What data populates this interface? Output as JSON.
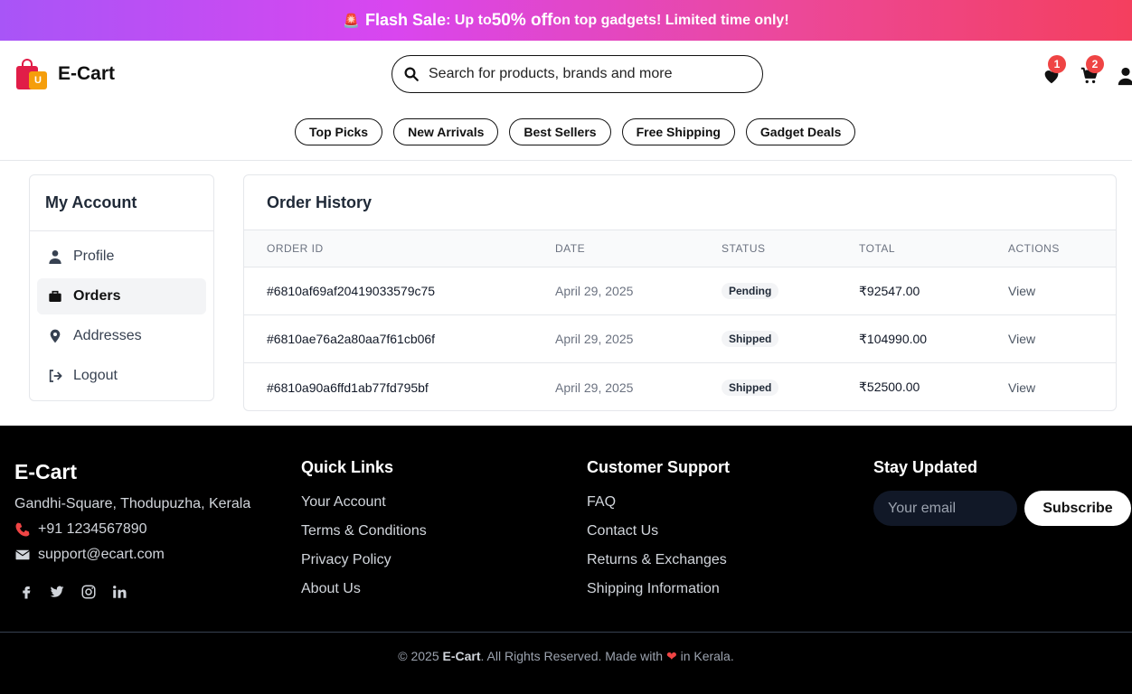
{
  "banner": {
    "siren": "🚨",
    "flash": "Flash Sale",
    "pre": ": Up to ",
    "discount": "50% off",
    "post": " on top gadgets! Limited time only!"
  },
  "header": {
    "brand": "E-Cart",
    "logo_letter": "U",
    "search_placeholder": "Search for products, brands and more",
    "wishlist_count": "1",
    "cart_count": "2",
    "chips": [
      "Top Picks",
      "New Arrivals",
      "Best Sellers",
      "Free Shipping",
      "Gadget Deals"
    ]
  },
  "sidebar": {
    "title": "My Account",
    "items": [
      {
        "label": "Profile",
        "icon": "user-icon"
      },
      {
        "label": "Orders",
        "icon": "briefcase-icon",
        "active": true
      },
      {
        "label": "Addresses",
        "icon": "map-pin-icon"
      },
      {
        "label": "Logout",
        "icon": "logout-icon"
      }
    ]
  },
  "orders": {
    "title": "Order History",
    "columns": [
      "ORDER ID",
      "DATE",
      "STATUS",
      "TOTAL",
      "ACTIONS"
    ],
    "rows": [
      {
        "id": "#6810af69af20419033579c75",
        "date": "April 29, 2025",
        "status": "Pending",
        "total": "₹92547.00",
        "action": "View"
      },
      {
        "id": "#6810ae76a2a80aa7f61cb06f",
        "date": "April 29, 2025",
        "status": "Shipped",
        "total": "₹104990.00",
        "action": "View"
      },
      {
        "id": "#6810a90a6ffd1ab77fd795bf",
        "date": "April 29, 2025",
        "status": "Shipped",
        "total": "₹52500.00",
        "action": "View"
      }
    ]
  },
  "footer": {
    "brand": "E-Cart",
    "address": "Gandhi-Square, Thodupuzha, Kerala",
    "phone": "+91 1234567890",
    "email": "support@ecart.com",
    "quick_links_title": "Quick Links",
    "quick_links": [
      "Your Account",
      "Terms & Conditions",
      "Privacy Policy",
      "About Us"
    ],
    "support_title": "Customer Support",
    "support_links": [
      "FAQ",
      "Contact Us",
      "Returns & Exchanges",
      "Shipping Information"
    ],
    "newsletter_title": "Stay Updated",
    "email_placeholder": "Your email",
    "subscribe_label": "Subscribe",
    "copyright_pre": "© 2025 ",
    "copyright_brand": "E-Cart",
    "copyright_mid": ". All Rights Reserved. Made with ",
    "copyright_heart": "❤",
    "copyright_post": " in Kerala."
  }
}
